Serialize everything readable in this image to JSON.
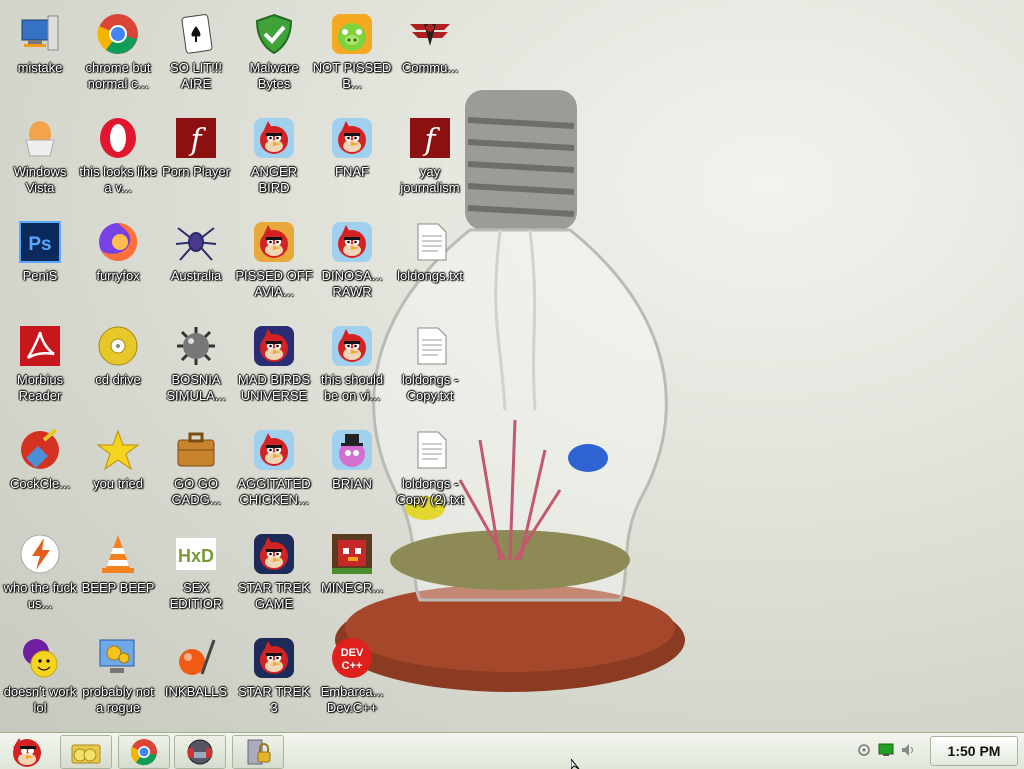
{
  "desktop": {
    "icons": [
      {
        "label": "mistake",
        "name": "computer-icon"
      },
      {
        "label": "chrome but normal c...",
        "name": "chrome-icon"
      },
      {
        "label": "SO LIT!!! AIRE",
        "name": "solitaire-icon"
      },
      {
        "label": "Malware Bytes",
        "name": "shield-icon"
      },
      {
        "label": "NOT PISSED B...",
        "name": "pig-icon"
      },
      {
        "label": "Commu...",
        "name": "eagle-emblem-icon"
      },
      {
        "label": "Windows Vista",
        "name": "egg-icon"
      },
      {
        "label": "this looks like a v...",
        "name": "opera-icon"
      },
      {
        "label": "Porn Player",
        "name": "flash-icon"
      },
      {
        "label": "ANGER BIRD",
        "name": "angry-bird-icon"
      },
      {
        "label": "FNAF",
        "name": "angry-bird-icon"
      },
      {
        "label": "yay journalism",
        "name": "flash-icon"
      },
      {
        "label": "PeniS",
        "name": "photoshop-icon"
      },
      {
        "label": "furryfox",
        "name": "firefox-icon"
      },
      {
        "label": "Australia",
        "name": "spider-icon"
      },
      {
        "label": "PISSED OFF AVIA...",
        "name": "angry-bird-seasons-icon"
      },
      {
        "label": "DINOSA... RAWR",
        "name": "angry-bird-icon"
      },
      {
        "label": "loldongs.txt",
        "name": "text-file-icon"
      },
      {
        "label": "Morbius Reader",
        "name": "pdf-reader-icon"
      },
      {
        "label": "cd drive",
        "name": "cd-icon"
      },
      {
        "label": "BOSNIA SIMULA...",
        "name": "mine-icon"
      },
      {
        "label": "MAD BIRDS UNIVERSE",
        "name": "angry-bird-space-icon"
      },
      {
        "label": "this should be on vi...",
        "name": "angry-bird-icon"
      },
      {
        "label": "loldongs - Copy.txt",
        "name": "text-file-icon"
      },
      {
        "label": "CockCle...",
        "name": "broom-icon"
      },
      {
        "label": "you tried",
        "name": "star-icon"
      },
      {
        "label": "GO GO GADG...",
        "name": "briefcase-icon"
      },
      {
        "label": "AGGITATED CHICKEN...",
        "name": "angry-bird-icon"
      },
      {
        "label": "BRIAN",
        "name": "angry-bird-rio-icon"
      },
      {
        "label": "loldongs - Copy (2).txt",
        "name": "text-file-icon"
      },
      {
        "label": "who the fuck us...",
        "name": "bolt-icon"
      },
      {
        "label": "BEEP BEEP",
        "name": "vlc-cone-icon"
      },
      {
        "label": "SEX EDITIOR",
        "name": "hex-editor-icon"
      },
      {
        "label": "STAR TREK GAME",
        "name": "star-wars-bird-icon"
      },
      {
        "label": "MINECR...",
        "name": "minecraft-bird-icon"
      },
      {
        "label": "doesn't work lol",
        "name": "yahoo-messenger-icon"
      },
      {
        "label": "probably not a rogue",
        "name": "gears-icon"
      },
      {
        "label": "INKBALLS",
        "name": "inkball-icon"
      },
      {
        "label": "STAR TREK 3",
        "name": "star-wars-bird-icon"
      },
      {
        "label": "Embarca... Dev.C++",
        "name": "devcpp-icon"
      }
    ],
    "devcpp_text": "DEV C++",
    "ps_text": "Ps",
    "hxd_text": "HxD"
  },
  "taskbar": {
    "clock": "1:50 PM",
    "items": [
      "start-bird-icon",
      "file-manager-icon",
      "chrome-icon",
      "headphones-app-icon",
      "security-lock-icon"
    ]
  }
}
